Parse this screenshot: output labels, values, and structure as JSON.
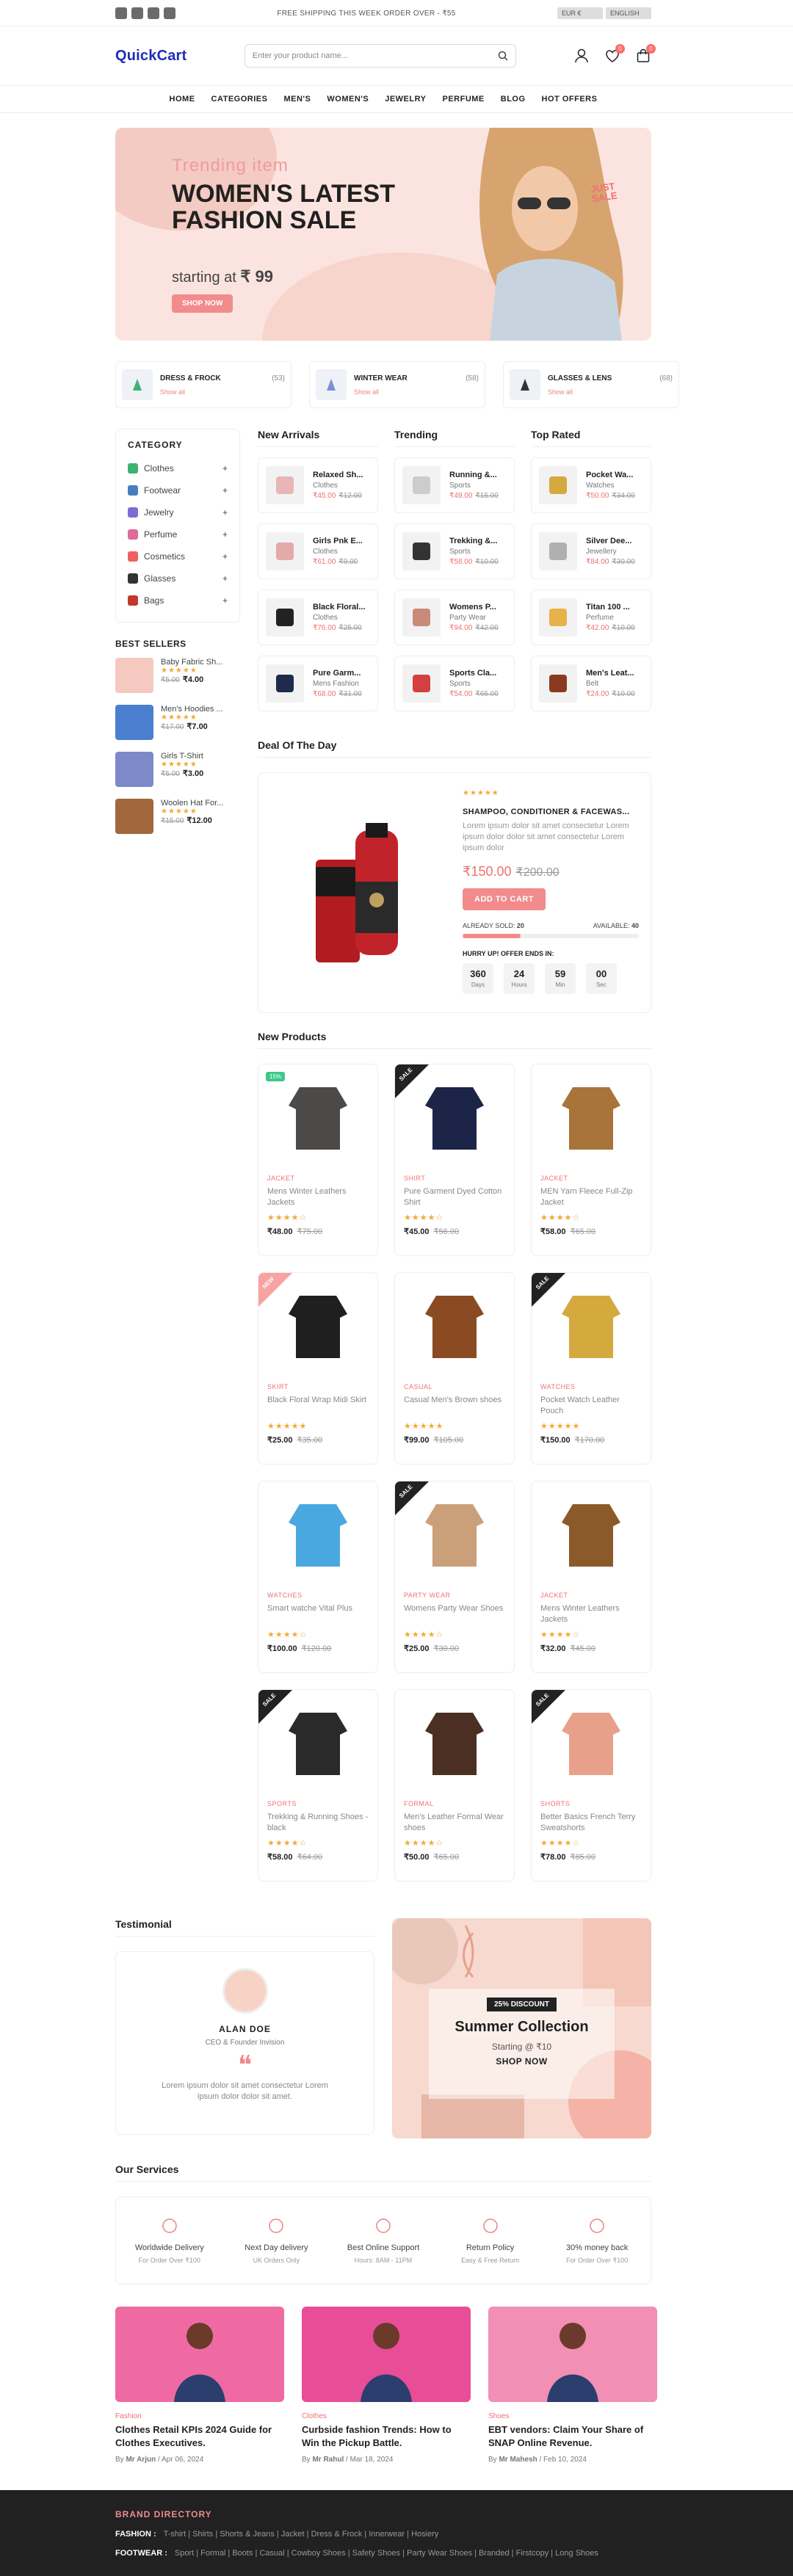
{
  "topbar": {
    "message": "FREE SHIPPING THIS WEEK ORDER OVER - ₹55",
    "currency": "EUR €",
    "language": "ENGLISH"
  },
  "header": {
    "logo": "QuickCart",
    "search_placeholder": "Enter your product name...",
    "wishlist_count": "0",
    "cart_count": "0"
  },
  "nav": [
    "HOME",
    "CATEGORIES",
    "MEN'S",
    "WOMEN'S",
    "JEWELRY",
    "PERFUME",
    "BLOG",
    "HOT OFFERS"
  ],
  "hero": {
    "subtitle": "Trending item",
    "title": "WOMEN'S LATEST FASHION SALE",
    "starting": "starting at ",
    "price": "₹ 99",
    "button": "SHOP NOW",
    "sale_badge": "JUST SALE"
  },
  "category_strip": [
    {
      "name": "DRESS & FROCK",
      "count": "(53)",
      "link": "Show all"
    },
    {
      "name": "WINTER WEAR",
      "count": "(58)",
      "link": "Show all"
    },
    {
      "name": "GLASSES & LENS",
      "count": "(68)",
      "link": "Show all"
    }
  ],
  "sidebar": {
    "title": "CATEGORY",
    "items": [
      {
        "label": "Clothes",
        "color": "#3cb371"
      },
      {
        "label": "Footwear",
        "color": "#4a7dbf"
      },
      {
        "label": "Jewelry",
        "color": "#7b6fd6"
      },
      {
        "label": "Perfume",
        "color": "#e06b9a"
      },
      {
        "label": "Cosmetics",
        "color": "#f06060"
      },
      {
        "label": "Glasses",
        "color": "#333333"
      },
      {
        "label": "Bags",
        "color": "#c0392b"
      }
    ],
    "plus": "+",
    "best_title": "BEST SELLERS",
    "best": [
      {
        "name": "Baby Fabric Sh...",
        "old": "₹5.00",
        "price": "₹4.00",
        "stars": "★★★★★",
        "color": "#f6c9c0"
      },
      {
        "name": "Men's Hoodies ...",
        "old": "₹17.00",
        "price": "₹7.00",
        "stars": "★★★★★",
        "color": "#4a7fcf"
      },
      {
        "name": "Girls T-Shirt",
        "old": "₹5.00",
        "price": "₹3.00",
        "stars": "★★★★★",
        "color": "#7d89c9"
      },
      {
        "name": "Woolen Hat For...",
        "old": "₹15.00",
        "price": "₹12.00",
        "stars": "★★★★★",
        "color": "#a0683c"
      }
    ]
  },
  "trio": [
    {
      "title": "New Arrivals",
      "items": [
        {
          "name": "Relaxed Sh...",
          "cat": "Clothes",
          "price": "₹45.00",
          "old": "₹12.00",
          "color": "#e8b6b6"
        },
        {
          "name": "Girls Pnk E...",
          "cat": "Clothes",
          "price": "₹61.00",
          "old": "₹9.00",
          "color": "#e4a9a9"
        },
        {
          "name": "Black Floral...",
          "cat": "Clothes",
          "price": "₹76.00",
          "old": "₹25.00",
          "color": "#222222"
        },
        {
          "name": "Pure Garm...",
          "cat": "Mens Fashion",
          "price": "₹68.00",
          "old": "₹31.00",
          "color": "#1e2b4d"
        }
      ]
    },
    {
      "title": "Trending",
      "items": [
        {
          "name": "Running &...",
          "cat": "Sports",
          "price": "₹49.00",
          "old": "₹15.00",
          "color": "#cccccc"
        },
        {
          "name": "Trekking &...",
          "cat": "Sports",
          "price": "₹58.00",
          "old": "₹10.00",
          "color": "#333333"
        },
        {
          "name": "Womens P...",
          "cat": "Party Wear",
          "price": "₹94.00",
          "old": "₹42.00",
          "color": "#c98a7a"
        },
        {
          "name": "Sports Cla...",
          "cat": "Sports",
          "price": "₹54.00",
          "old": "₹65.00",
          "color": "#d44040"
        }
      ]
    },
    {
      "title": "Top Rated",
      "items": [
        {
          "name": "Pocket Wa...",
          "cat": "Watches",
          "price": "₹50.00",
          "old": "₹34.00",
          "color": "#d4a93e"
        },
        {
          "name": "Silver Dee...",
          "cat": "Jewellery",
          "price": "₹84.00",
          "old": "₹30.00",
          "color": "#b0b0b0"
        },
        {
          "name": "Titan 100 ...",
          "cat": "Perfume",
          "price": "₹42.00",
          "old": "₹10.00",
          "color": "#e8b24a"
        },
        {
          "name": "Men's Leat...",
          "cat": "Belt",
          "price": "₹24.00",
          "old": "₹10.00",
          "color": "#8b3a22"
        }
      ]
    }
  ],
  "deal": {
    "heading": "Deal Of The Day",
    "stars": "★★★★★",
    "title": "SHAMPOO, CONDITIONER & FACEWAS...",
    "desc": "Lorem ipsum dolor sit amet consectetur Lorem ipsum dolor dolor sit amet consectetur Lorem ipsum dolor",
    "price": "₹150.00",
    "old": "₹200.00",
    "button": "ADD TO CART",
    "sold_label": "ALREADY SOLD:",
    "sold": "20",
    "avail_label": "AVAILABLE:",
    "avail": "40",
    "sold_fraction": 0.33,
    "hurry": "HURRY UP! OFFER ENDS IN:",
    "timer": [
      {
        "v": "360",
        "l": "Days"
      },
      {
        "v": "24",
        "l": "Hours"
      },
      {
        "v": "59",
        "l": "Min"
      },
      {
        "v": "00",
        "l": "Sec"
      }
    ]
  },
  "new_products": {
    "heading": "New Products",
    "items": [
      {
        "cat": "JACKET",
        "name": "Mens Winter Leathers Jackets",
        "price": "₹48.00",
        "old": "₹75.00",
        "stars": "★★★★☆",
        "tag": "15%",
        "tagtype": "disc",
        "color": "#4b4a48"
      },
      {
        "cat": "SHIRT",
        "name": "Pure Garment Dyed Cotton Shirt",
        "price": "₹45.00",
        "old": "₹56.00",
        "stars": "★★★★☆",
        "tag": "SALE",
        "tagtype": "dark",
        "color": "#1c2448"
      },
      {
        "cat": "JACKET",
        "name": "MEN Yarn Fleece Full-Zip Jacket",
        "price": "₹58.00",
        "old": "₹65.00",
        "stars": "★★★★☆",
        "tag": "",
        "tagtype": "",
        "color": "#a8743a"
      },
      {
        "cat": "SKIRT",
        "name": "Black Floral Wrap Midi Skirt",
        "price": "₹25.00",
        "old": "₹35.00",
        "stars": "★★★★★",
        "tag": "NEW",
        "tagtype": "pink",
        "color": "#1f1f1f"
      },
      {
        "cat": "CASUAL",
        "name": "Casual Men's Brown shoes",
        "price": "₹99.00",
        "old": "₹105.00",
        "stars": "★★★★★",
        "tag": "",
        "tagtype": "",
        "color": "#8a4a22"
      },
      {
        "cat": "WATCHES",
        "name": "Pocket Watch Leather Pouch",
        "price": "₹150.00",
        "old": "₹170.00",
        "stars": "★★★★★",
        "tag": "SALE",
        "tagtype": "dark",
        "color": "#d4a93e"
      },
      {
        "cat": "WATCHES",
        "name": "Smart watche Vital Plus",
        "price": "₹100.00",
        "old": "₹120.00",
        "stars": "★★★★☆",
        "tag": "",
        "tagtype": "",
        "color": "#4aa8e0"
      },
      {
        "cat": "PARTY WEAR",
        "name": "Womens Party Wear Shoes",
        "price": "₹25.00",
        "old": "₹30.00",
        "stars": "★★★★☆",
        "tag": "SALE",
        "tagtype": "dark",
        "color": "#c9a07a"
      },
      {
        "cat": "JACKET",
        "name": "Mens Winter Leathers Jackets",
        "price": "₹32.00",
        "old": "₹45.00",
        "stars": "★★★★☆",
        "tag": "",
        "tagtype": "",
        "color": "#8b5a2b"
      },
      {
        "cat": "SPORTS",
        "name": "Trekking & Running Shoes - black",
        "price": "₹58.00",
        "old": "₹64.00",
        "stars": "★★★★☆",
        "tag": "SALE",
        "tagtype": "dark",
        "color": "#2a2a2a"
      },
      {
        "cat": "FORMAL",
        "name": "Men's Leather Formal Wear shoes",
        "price": "₹50.00",
        "old": "₹65.00",
        "stars": "★★★★☆",
        "tag": "",
        "tagtype": "",
        "color": "#4a2f22"
      },
      {
        "cat": "SHORTS",
        "name": "Better Basics French Terry Sweatshorts",
        "price": "₹78.00",
        "old": "₹85.00",
        "stars": "★★★★☆",
        "tag": "SALE",
        "tagtype": "dark",
        "color": "#e8a08a"
      }
    ]
  },
  "testimonial": {
    "heading": "Testimonial",
    "name": "ALAN DOE",
    "role": "CEO & Founder Invision",
    "quote_mark": "❝",
    "text": "Lorem ipsum dolor sit amet consectetur Lorem ipsum dolor dolor sit amet."
  },
  "promo": {
    "discount": "25% DISCOUNT",
    "title": "Summer Collection",
    "sub": "Starting @ ₹10",
    "link": "SHOP NOW"
  },
  "services": {
    "heading": "Our Services",
    "items": [
      {
        "t": "Worldwide Delivery",
        "d": "For Order Over ₹100"
      },
      {
        "t": "Next Day delivery",
        "d": "UK Orders Only"
      },
      {
        "t": "Best Online Support",
        "d": "Hours: 8AM - 11PM"
      },
      {
        "t": "Return Policy",
        "d": "Easy & Free Return"
      },
      {
        "t": "30% money back",
        "d": "For Order Over ₹100"
      }
    ]
  },
  "blog": [
    {
      "cat": "Fashion",
      "title": "Clothes Retail KPIs 2024 Guide for Clothes Executives.",
      "by": "By ",
      "author": "Mr Arjun",
      "date": " / Apr 06, 2024",
      "color": "#ef6aa2"
    },
    {
      "cat": "Clothes",
      "title": "Curbside fashion Trends: How to Win the Pickup Battle.",
      "by": "By ",
      "author": "Mr Rahul",
      "date": " / Mar 18, 2024",
      "color": "#e84d97"
    },
    {
      "cat": "Shoes",
      "title": "EBT vendors: Claim Your Share of SNAP Online Revenue.",
      "by": "By ",
      "author": "Mr Mahesh",
      "date": " / Feb 10, 2024",
      "color": "#f18fb5"
    }
  ],
  "footer": {
    "title": "BRAND DIRECTORY",
    "rows": [
      {
        "label": "FASHION :",
        "items": "T-shirt  |  Shirts  |  Shorts & Jeans  |  Jacket  |  Dress & Frock  |  Innerwear  |  Hosiery"
      },
      {
        "label": "FOOTWEAR :",
        "items": "Sport  |  Formal  |  Boots  |  Casual  |  Cowboy Shoes  |  Safety Shoes  |  Party Wear Shoes  |  Branded  |  Firstcopy  |  Long Shoes"
      }
    ]
  }
}
